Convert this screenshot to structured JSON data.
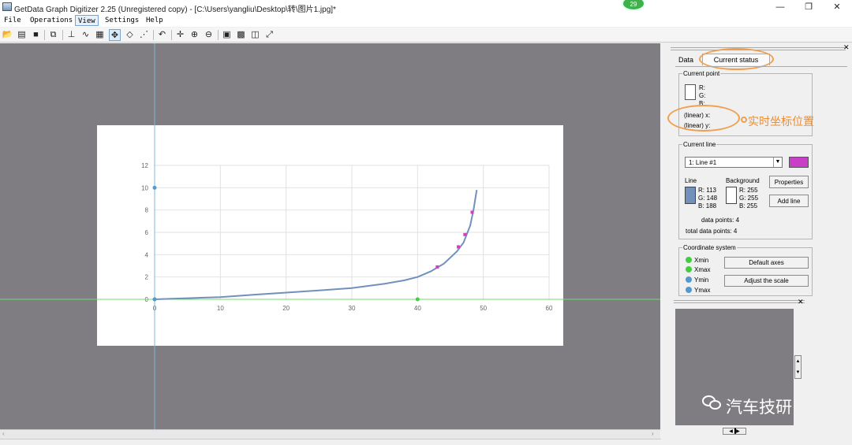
{
  "window": {
    "title": "GetData Graph Digitizer 2.25 (Unregistered copy) - [C:\\Users\\yangliu\\Desktop\\转\\图片1.jpg]*",
    "badge": "29",
    "min_glyph": "—",
    "max_glyph": "❐",
    "close_glyph": "✕"
  },
  "menu": [
    {
      "label": "File"
    },
    {
      "label": "Operations"
    },
    {
      "label": "View"
    },
    {
      "label": "Settings"
    },
    {
      "label": "Help"
    }
  ],
  "toolbar": {
    "icons": [
      "open-icon",
      "scan-icon",
      "save-icon",
      "copy-icon",
      "axes-icon",
      "auto-trace-icon",
      "grid-icon",
      "point-icon",
      "eraser-icon",
      "line-icon",
      "undo-icon",
      "move-icon",
      "zoom-in-icon",
      "zoom-out-icon",
      "image-icon",
      "table-icon",
      "window-icon",
      "fit-icon"
    ]
  },
  "chart_data": {
    "type": "line",
    "x_ticks": [
      "0",
      "10",
      "20",
      "30",
      "40",
      "50",
      "60"
    ],
    "y_ticks": [
      "0",
      "2",
      "4",
      "6",
      "8",
      "10",
      "12"
    ],
    "xlim": [
      0,
      60
    ],
    "ylim": [
      0,
      12
    ],
    "grid": true,
    "curve": [
      [
        0,
        0
      ],
      [
        5,
        0.1
      ],
      [
        10,
        0.2
      ],
      [
        15,
        0.4
      ],
      [
        20,
        0.6
      ],
      [
        25,
        0.8
      ],
      [
        30,
        1.0
      ],
      [
        35,
        1.4
      ],
      [
        38,
        1.7
      ],
      [
        40,
        2.0
      ],
      [
        42,
        2.5
      ],
      [
        44,
        3.2
      ],
      [
        46,
        4.3
      ],
      [
        47,
        5.1
      ],
      [
        48,
        6.6
      ],
      [
        48.5,
        8.0
      ],
      [
        49,
        9.8
      ]
    ],
    "digitized_points": [
      [
        43,
        2.9
      ],
      [
        46.2,
        4.7
      ],
      [
        47.2,
        5.8
      ],
      [
        48.3,
        7.8
      ]
    ],
    "axis_markers": {
      "x": [
        0,
        40
      ],
      "y": [
        0,
        10
      ]
    },
    "line_color": "#7190bc",
    "marker_color": "#d040c0",
    "axis_line_color": "#6cdc6c"
  },
  "panel": {
    "tabs": [
      {
        "label": "Data"
      },
      {
        "label": "Current status"
      }
    ],
    "current_point": {
      "legend": "Current point",
      "r": "R:",
      "g": "G:",
      "b": "B:",
      "x_label": "(linear)  x:",
      "y_label": "(linear)  y:"
    },
    "annotation": {
      "text": "实时坐标位置"
    },
    "current_line": {
      "legend": "Current line",
      "selected": "1: Line #1",
      "line_color": "#c840c8",
      "line_label": "Line",
      "bg_label": "Background",
      "line_r": "R: 113",
      "line_g": "G: 148",
      "line_b": "B: 188",
      "bg_r": "R: 255",
      "bg_g": "G: 255",
      "bg_b": "B: 255",
      "properties": "Properties",
      "add_line": "Add line",
      "data_points": "data points:  4",
      "total_points": "total data points:  4"
    },
    "coord": {
      "legend": "Coordinate system",
      "xmin": "Xmin",
      "xmax": "Xmax",
      "ymin": "Ymin",
      "ymax": "Ymax",
      "default_axes": "Default axes",
      "adjust_scale": "Adjust the scale",
      "green": "#44cc44",
      "blue": "#5599cc"
    }
  },
  "watermark": {
    "text": "汽车技研"
  }
}
